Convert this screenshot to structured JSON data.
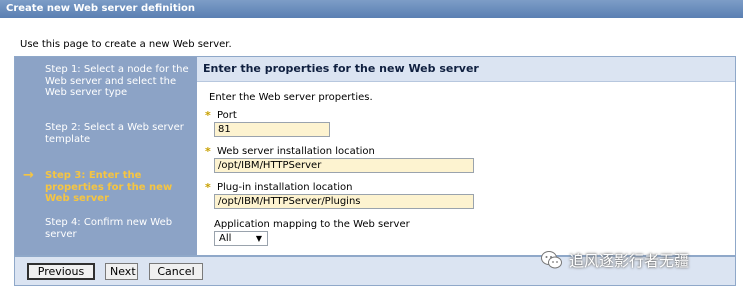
{
  "window": {
    "title": "Create new Web server definition"
  },
  "intro_text": "Use this page to create a new Web server.",
  "steps": [
    {
      "label": "Step 1: Select a node for the Web server and select the Web server type",
      "current": false
    },
    {
      "label": "Step 2: Select a Web server template",
      "current": false
    },
    {
      "label": "Step 3: Enter the properties for the new Web server",
      "current": true
    },
    {
      "label": "Step 4: Confirm new Web server",
      "current": false
    }
  ],
  "content": {
    "header": "Enter the properties for the new Web server",
    "description": "Enter the Web server properties.",
    "required_marker": "*",
    "fields": {
      "port": {
        "label": "Port",
        "value": "81"
      },
      "install_location": {
        "label": "Web server installation location",
        "value": "/opt/IBM/HTTPServer"
      },
      "plugin_location": {
        "label": "Plug-in installation location",
        "value": "/opt/IBM/HTTPServer/Plugins"
      }
    },
    "app_mapping": {
      "label": "Application mapping to the Web server",
      "selected": "All"
    }
  },
  "buttons": {
    "previous": "Previous",
    "next": "Next",
    "cancel": "Cancel"
  },
  "watermark": {
    "text": "追风逐影行者无疆"
  },
  "colors": {
    "title_bar": "#5a7fb2",
    "steps_bg": "#8ca3c6",
    "current_step": "#f5c542",
    "header_bg": "#dbe4f2",
    "input_bg": "#fdf3d0",
    "required": "#c8a000"
  }
}
